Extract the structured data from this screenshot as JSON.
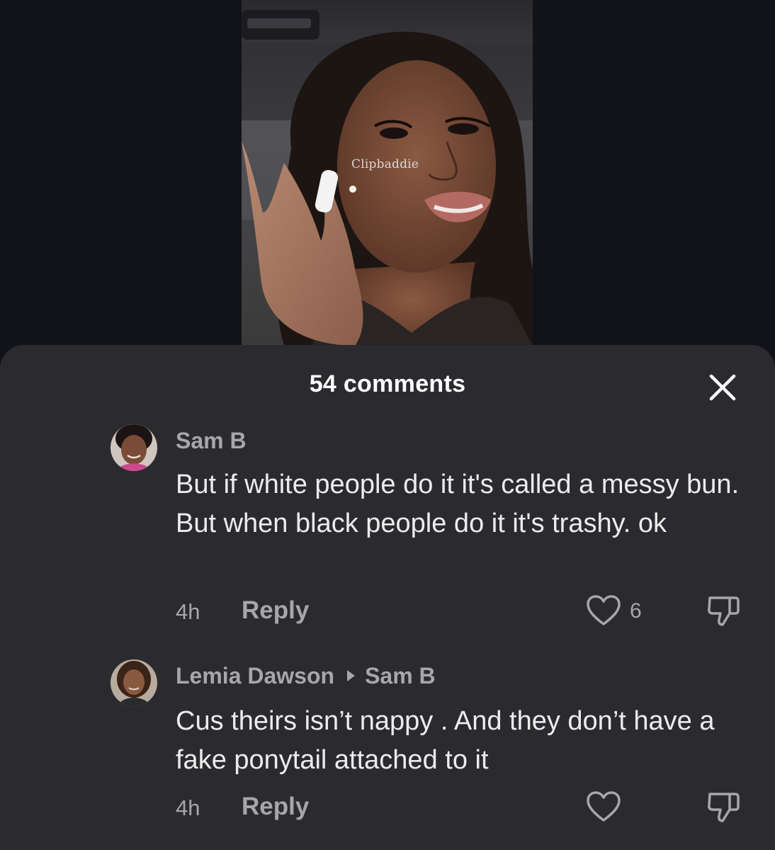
{
  "video": {
    "watermark": "Clipbaddie"
  },
  "comments_sheet": {
    "title": "54 comments",
    "close_icon": "close-icon",
    "comments": [
      {
        "author": "Sam B",
        "reply_to": "",
        "text": "But if white people do it it's called a messy bun. But when black people do it it's trashy. ok",
        "time": "4h",
        "reply_label": "Reply",
        "likes": "6"
      },
      {
        "author": "Lemia Dawson",
        "reply_to": "Sam B",
        "text": "Cus theirs isn’t nappy . And they don’t have a fake ponytail attached to it",
        "time": "4h",
        "reply_label": "Reply",
        "likes": ""
      }
    ]
  },
  "colors": {
    "sheet_bg": "#2b2b2f",
    "page_bg": "#121219",
    "muted_text": "#a6a6ab",
    "body_text": "#ececec"
  }
}
